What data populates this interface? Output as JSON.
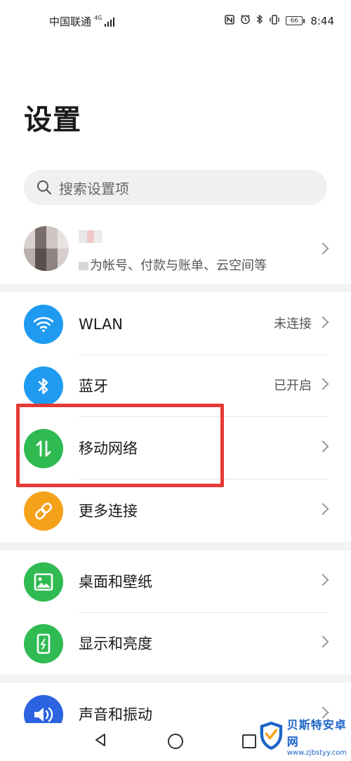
{
  "status_bar": {
    "carrier": "中国联通",
    "network_type": "4G",
    "time": "8:44",
    "battery": "66"
  },
  "page": {
    "title": "设置"
  },
  "search": {
    "placeholder": "搜索设置项"
  },
  "account": {
    "description": "为帐号、付款与账单、云空间等"
  },
  "items": {
    "wlan": {
      "label": "WLAN",
      "value": "未连接",
      "icon": "wifi-icon",
      "color": "#1e9bf0"
    },
    "bluetooth": {
      "label": "蓝牙",
      "value": "已开启",
      "icon": "bluetooth-icon",
      "color": "#1e9bf0"
    },
    "mobile_network": {
      "label": "移动网络",
      "icon": "mobile-data-icon",
      "color": "#2fba52"
    },
    "more_connections": {
      "label": "更多连接",
      "icon": "link-icon",
      "color": "#f5a21b"
    },
    "wallpaper": {
      "label": "桌面和壁纸",
      "icon": "image-icon",
      "color": "#2fba52"
    },
    "display": {
      "label": "显示和亮度",
      "icon": "display-brightness-icon",
      "color": "#2fba52"
    },
    "sound": {
      "label": "声音和振动",
      "icon": "volume-icon",
      "color": "#2b63e0"
    }
  },
  "highlight": {
    "color": "#e53935"
  },
  "watermark": {
    "title": "贝斯特安卓网",
    "url": "www.zjbstyy.com"
  }
}
